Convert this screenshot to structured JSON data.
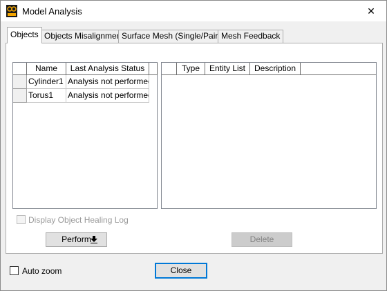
{
  "window": {
    "title": "Model Analysis",
    "close_glyph": "✕",
    "icon": "app-logo-icon"
  },
  "tabs": [
    {
      "label": "Objects",
      "active": true
    },
    {
      "label": "Objects Misalignment",
      "active": false
    },
    {
      "label": "Surface Mesh (Single/Pairs)",
      "active": false
    },
    {
      "label": "Mesh Feedback",
      "active": false
    }
  ],
  "objects_table": {
    "columns": [
      "Name",
      "Last Analysis Status"
    ],
    "rows": [
      {
        "name": "Cylinder1",
        "status": "Analysis not performed"
      },
      {
        "name": "Torus1",
        "status": "Analysis not performed"
      }
    ]
  },
  "results_table": {
    "columns": [
      "Type",
      "Entity List",
      "Description"
    ]
  },
  "healing_log": {
    "label": "Display Object Healing Log",
    "checked": false,
    "enabled": false
  },
  "perform_button": {
    "label": "Perform",
    "icon": "arrow-down-icon",
    "glyph": "🠗"
  },
  "delete_button": {
    "label": "Delete",
    "enabled": false
  },
  "auto_zoom": {
    "label": "Auto zoom",
    "checked": false
  },
  "close_button": {
    "label": "Close"
  }
}
